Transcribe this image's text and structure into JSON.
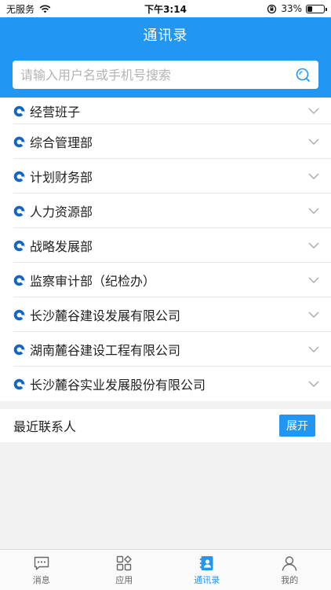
{
  "status_bar": {
    "carrier": "无服务",
    "time": "下午3:14",
    "battery_percent": "33%",
    "battery_level": 0.33
  },
  "header": {
    "title": "通讯录"
  },
  "search": {
    "placeholder": "请输入用户名或手机号搜索"
  },
  "departments": [
    {
      "label": "经营班子"
    },
    {
      "label": "综合管理部"
    },
    {
      "label": "计划财务部"
    },
    {
      "label": "人力资源部"
    },
    {
      "label": "战略发展部"
    },
    {
      "label": "监察审计部（纪检办）"
    },
    {
      "label": "长沙麓谷建设发展有限公司"
    },
    {
      "label": "湖南麓谷建设工程有限公司"
    },
    {
      "label": "长沙麓谷实业发展股份有限公司"
    }
  ],
  "recent": {
    "title": "最近联系人",
    "expand_label": "展开"
  },
  "tabs": [
    {
      "label": "消息",
      "icon": "message-icon",
      "active": false
    },
    {
      "label": "应用",
      "icon": "apps-icon",
      "active": false
    },
    {
      "label": "通讯录",
      "icon": "contacts-icon",
      "active": true
    },
    {
      "label": "我的",
      "icon": "profile-icon",
      "active": false
    }
  ],
  "colors": {
    "accent": "#2196f3",
    "background": "#f2f2f2"
  }
}
